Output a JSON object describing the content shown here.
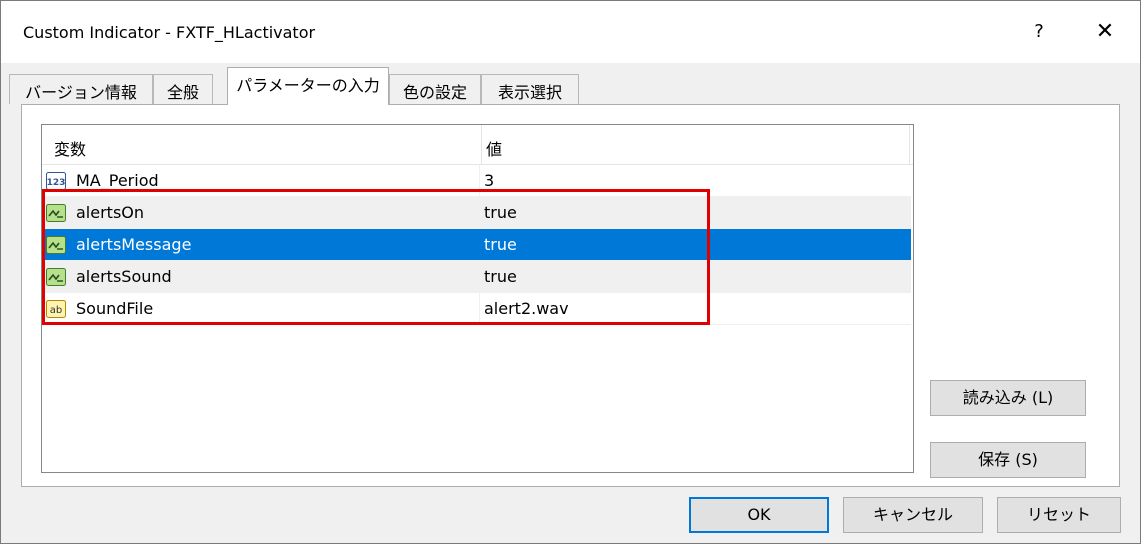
{
  "window": {
    "title": "Custom Indicator - FXTF_HLactivator",
    "help_label": "?",
    "close_label": "✕"
  },
  "tabs": [
    {
      "label": "バージョン情報",
      "active": false
    },
    {
      "label": "全般",
      "active": false
    },
    {
      "label": "パラメーターの入力",
      "active": true
    },
    {
      "label": "色の設定",
      "active": false
    },
    {
      "label": "表示選択",
      "active": false
    }
  ],
  "grid": {
    "headers": {
      "name": "変数",
      "value": "値"
    },
    "rows": [
      {
        "name": "MA_Period",
        "value": "3",
        "icon": "integer-icon"
      },
      {
        "name": "alertsOn",
        "value": "true",
        "icon": "boolean-icon"
      },
      {
        "name": "alertsMessage",
        "value": "true",
        "icon": "boolean-icon"
      },
      {
        "name": "alertsSound",
        "value": "true",
        "icon": "boolean-icon"
      },
      {
        "name": "SoundFile",
        "value": "alert2.wav",
        "icon": "string-icon"
      }
    ]
  },
  "side_buttons": {
    "load_label": "読み込み (L)",
    "save_label": "保存 (S)"
  },
  "footer_buttons": {
    "ok_label": "OK",
    "cancel_label": "キャンセル",
    "reset_label": "リセット"
  },
  "colors": {
    "selection": "#0078d7",
    "highlight_box": "#e00000"
  }
}
